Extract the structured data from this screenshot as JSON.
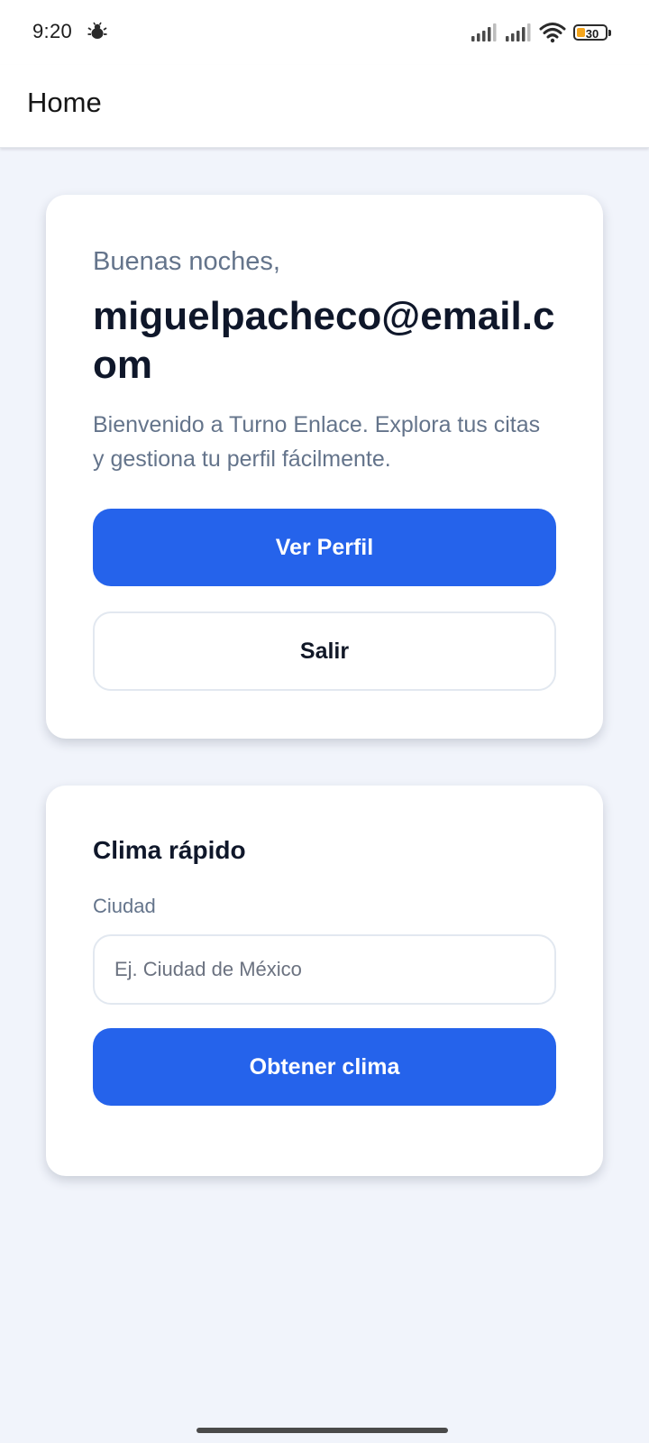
{
  "status_bar": {
    "time": "9:20",
    "notification_icon": "notification-bug-icon",
    "battery_level": "30",
    "battery_fraction": 0.3,
    "battery_color": "#f4a51c"
  },
  "app_bar": {
    "title": "Home"
  },
  "welcome_card": {
    "greeting": "Buenas noches,",
    "email": "miguelpacheco@email.com",
    "description": "Bienvenido a Turno Enlace. Explora tus citas y gestiona tu perfil fácilmente.",
    "profile_button_label": "Ver Perfil",
    "logout_button_label": "Salir"
  },
  "weather_card": {
    "title": "Clima rápido",
    "city_label": "Ciudad",
    "city_value": "",
    "city_placeholder": "Ej. Ciudad de México",
    "submit_button_label": "Obtener clima"
  },
  "colors": {
    "accent": "#2563eb",
    "background": "#f1f4fb",
    "text_primary": "#0f172a",
    "text_secondary": "#64748b"
  }
}
